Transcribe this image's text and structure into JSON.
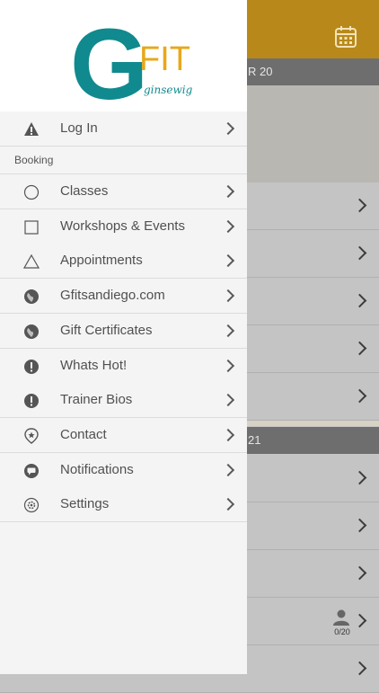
{
  "colors": {
    "accent": "#b8891a",
    "logo_teal": "#108a8e",
    "logo_gold": "#e8a81a"
  },
  "background": {
    "section1_label": "R 20",
    "section2_label": "21",
    "row_capacity": "0/20",
    "calendar_icon": "calendar-icon"
  },
  "logo": {
    "big_letter": "G",
    "fit": "FIT",
    "script": "ginsewig"
  },
  "menu": {
    "items": [
      {
        "label": "Log In",
        "icon": "warning-icon"
      },
      {
        "label": "Classes",
        "icon": "circle-icon"
      },
      {
        "label": "Workshops & Events",
        "icon": "square-icon"
      },
      {
        "label": "Appointments",
        "icon": "triangle-icon"
      },
      {
        "label": "Gfitsandiego.com",
        "icon": "globe-icon"
      },
      {
        "label": "Gift Certificates",
        "icon": "globe-icon"
      },
      {
        "label": "Whats Hot!",
        "icon": "exclamation-icon"
      },
      {
        "label": "Trainer Bios",
        "icon": "exclamation-icon"
      },
      {
        "label": "Contact",
        "icon": "location-pin-icon"
      },
      {
        "label": "Notifications",
        "icon": "chat-bubble-icon"
      },
      {
        "label": "Settings",
        "icon": "gear-icon"
      }
    ],
    "section_booking": "Booking"
  }
}
